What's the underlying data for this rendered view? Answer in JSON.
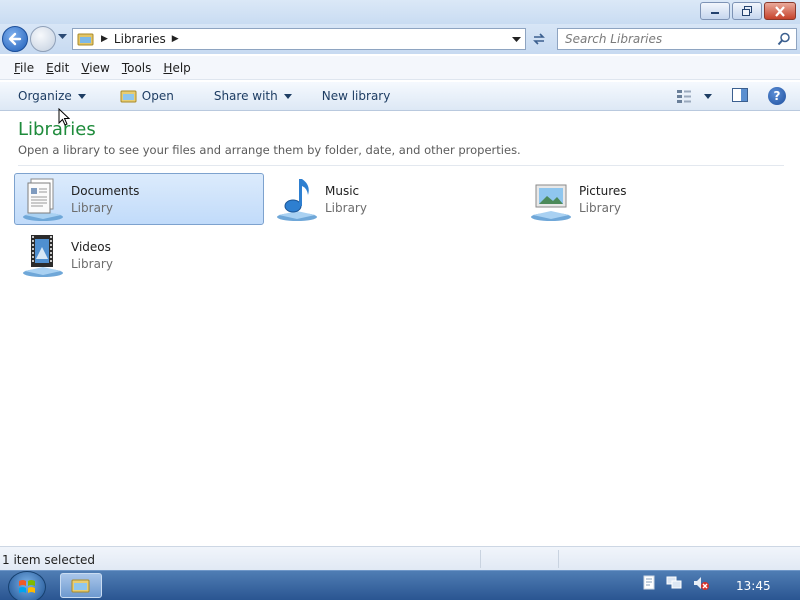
{
  "window": {
    "caption_buttons": [
      "minimize",
      "maximize",
      "close"
    ]
  },
  "navigation": {
    "breadcrumb": [
      "Libraries"
    ],
    "search_placeholder": "Search Libraries"
  },
  "menu": {
    "items": [
      "File",
      "Edit",
      "View",
      "Tools",
      "Help"
    ]
  },
  "commands": {
    "organize": "Organize",
    "open": "Open",
    "share_with": "Share with",
    "new_library": "New library"
  },
  "content": {
    "heading": "Libraries",
    "description": "Open a library to see your files and arrange them by folder, date, and other properties.",
    "libraries": [
      {
        "name": "Documents",
        "type": "Library",
        "icon": "documents-library-icon",
        "selected": true
      },
      {
        "name": "Music",
        "type": "Library",
        "icon": "music-library-icon",
        "selected": false
      },
      {
        "name": "Pictures",
        "type": "Library",
        "icon": "pictures-library-icon",
        "selected": false
      },
      {
        "name": "Videos",
        "type": "Library",
        "icon": "videos-library-icon",
        "selected": false
      }
    ]
  },
  "status": {
    "text": "1 item selected"
  },
  "taskbar": {
    "clock": "13:45"
  },
  "colors": {
    "heading": "#1e8b3b",
    "selection": "#c1dbfa",
    "taskbar": "#2a5591"
  }
}
